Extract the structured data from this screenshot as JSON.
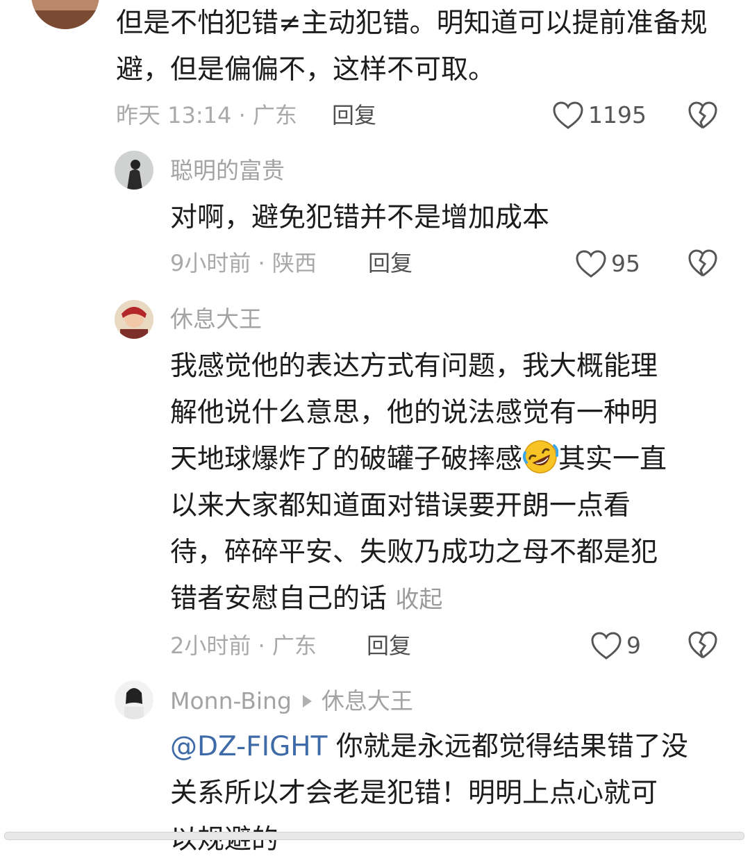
{
  "comments": [
    {
      "text": "但是不怕犯错≠主动犯错。明知道可以提前准备规避，但是偏偏不，这样不可取。",
      "time_location": "昨天 13:14 · 广东",
      "reply_label": "回复",
      "likes": "1195"
    },
    {
      "username": "聪明的富贵",
      "text": "对啊，避免犯错并不是增加成本",
      "time_location": "9小时前 · 陕西",
      "reply_label": "回复",
      "likes": "95"
    },
    {
      "username": "休息大王",
      "lines": [
        "我感觉他的表达方式有问题，我大概能理",
        "解他说什么意思，他的说法感觉有一种明",
        "天地球爆炸了的破罐子破摔感",
        "其实一直",
        "以来大家都知道面对错误要开朗一点看",
        "待，碎碎平安、失败乃成功之母不都是犯",
        "错者安慰自己的话"
      ],
      "collapse_label": "收起",
      "emoji": "rolling-on-floor-laughing",
      "time_location": "2小时前 · 广东",
      "reply_label": "回复",
      "likes": "9"
    },
    {
      "username": "Monn-Bing",
      "reply_to": "休息大王",
      "mention": "@DZ-FIGHT",
      "lines": [
        " 你就是永远都觉得结果错了没",
        "关系所以才会老是犯错！明明上点心就可",
        "以规避的"
      ]
    }
  ],
  "icons": {
    "like": "heart-outline-icon",
    "dislike": "broken-heart-icon",
    "reply_arrow": "triangle-right-icon"
  },
  "colors": {
    "mention": "#3f6aa8",
    "meta": "#a9a9a9"
  }
}
